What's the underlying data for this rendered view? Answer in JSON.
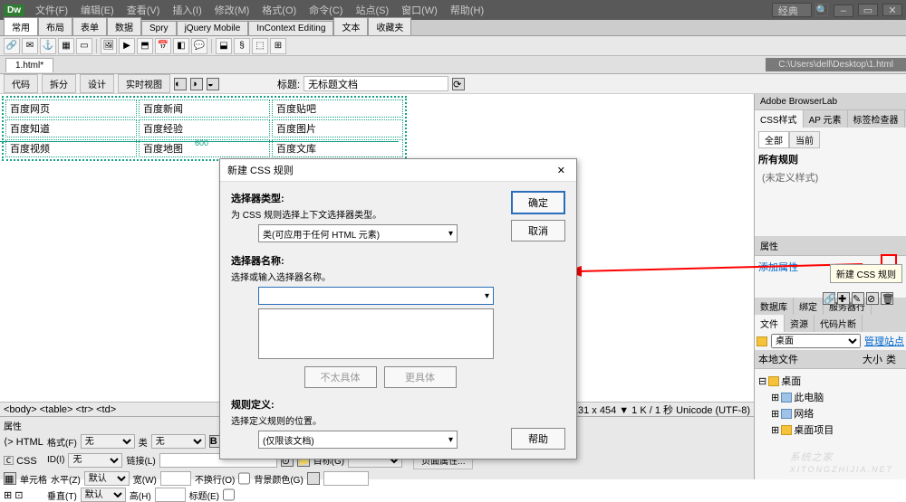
{
  "app": {
    "logo": "Dw",
    "layout_preset": "经典"
  },
  "menubar": [
    "文件(F)",
    "编辑(E)",
    "查看(V)",
    "插入(I)",
    "修改(M)",
    "格式(O)",
    "命令(C)",
    "站点(S)",
    "窗口(W)",
    "帮助(H)"
  ],
  "category_tabs": [
    "常用",
    "布局",
    "表单",
    "数据",
    "Spry",
    "jQuery Mobile",
    "InContext Editing",
    "文本",
    "收藏夹"
  ],
  "document": {
    "tab": "1.html*",
    "path": "C:\\Users\\dell\\Desktop\\1.html"
  },
  "view_modes": [
    "代码",
    "拆分",
    "设计",
    "实时视图"
  ],
  "title_label": "标题:",
  "title_value": "无标题文档",
  "table": {
    "rows": [
      [
        "百度网页",
        "百度新闻",
        "百度贴吧"
      ],
      [
        "百度知道",
        "百度经验",
        "百度图片"
      ],
      [
        "百度视频",
        "百度地图",
        "百度文库"
      ]
    ],
    "ruler_mark": "600"
  },
  "right": {
    "browserlab": "Adobe BrowserLab",
    "css_tabs": [
      "CSS样式",
      "AP 元素",
      "标签检查器"
    ],
    "css_sub": [
      "全部",
      "当前"
    ],
    "all_rules": "所有规则",
    "no_styles": "(未定义样式)",
    "props_title": "属性",
    "add_prop": "添加属性",
    "db_tabs": [
      "数据库",
      "绑定",
      "服务器行"
    ],
    "files_tabs": [
      "文件",
      "资源",
      "代码片断"
    ],
    "site_select": "桌面",
    "manage": "管理站点",
    "local_files": "本地文件",
    "col_size": "大小",
    "col_type": "类",
    "tree": [
      {
        "icon": "folder",
        "name": "桌面",
        "indent": 0
      },
      {
        "icon": "pc",
        "name": "此电脑",
        "indent": 1
      },
      {
        "icon": "pc",
        "name": "网络",
        "indent": 1
      },
      {
        "icon": "folder",
        "name": "桌面项目",
        "indent": 1
      }
    ]
  },
  "status": {
    "breadcrumb": "<body> <table> <tr> <td>",
    "info": "1131 x 454 ▼  1 K / 1 秒 Unicode (UTF-8)"
  },
  "props": {
    "title": "属性",
    "html_tab": "HTML",
    "css_tab": "CSS",
    "format": "格式(F)",
    "format_v": "无",
    "id": "ID(I)",
    "id_v": "无",
    "class": "类",
    "class_v": "无",
    "link": "链接(L)",
    "target": "目标(G)",
    "cell": "单元格",
    "horz": "水平(Z)",
    "horz_v": "默认",
    "width": "宽(W)",
    "nowrap": "不换行(O)",
    "bg": "背景颜色(G)",
    "vert": "垂直(T)",
    "vert_v": "默认",
    "height": "高(H)",
    "header": "标题(E)",
    "pageprops": "页面属性..."
  },
  "dialog": {
    "title": "新建 CSS 规则",
    "ok": "确定",
    "cancel": "取消",
    "help": "帮助",
    "sel_type": "选择器类型:",
    "sel_type_hint": "为 CSS 规则选择上下文选择器类型。",
    "sel_type_v": "类(可应用于任何 HTML 元素)",
    "sel_name": "选择器名称:",
    "sel_name_hint": "选择或输入选择器名称。",
    "less": "不太具体",
    "more": "更具体",
    "rule_def": "规则定义:",
    "rule_def_hint": "选择定义规则的位置。",
    "rule_def_v": "(仅限该文档)"
  },
  "tooltip": "新建 CSS 规则",
  "watermark": {
    "main": "系统之家",
    "sub": "XITONGZHIJIA.NET"
  }
}
